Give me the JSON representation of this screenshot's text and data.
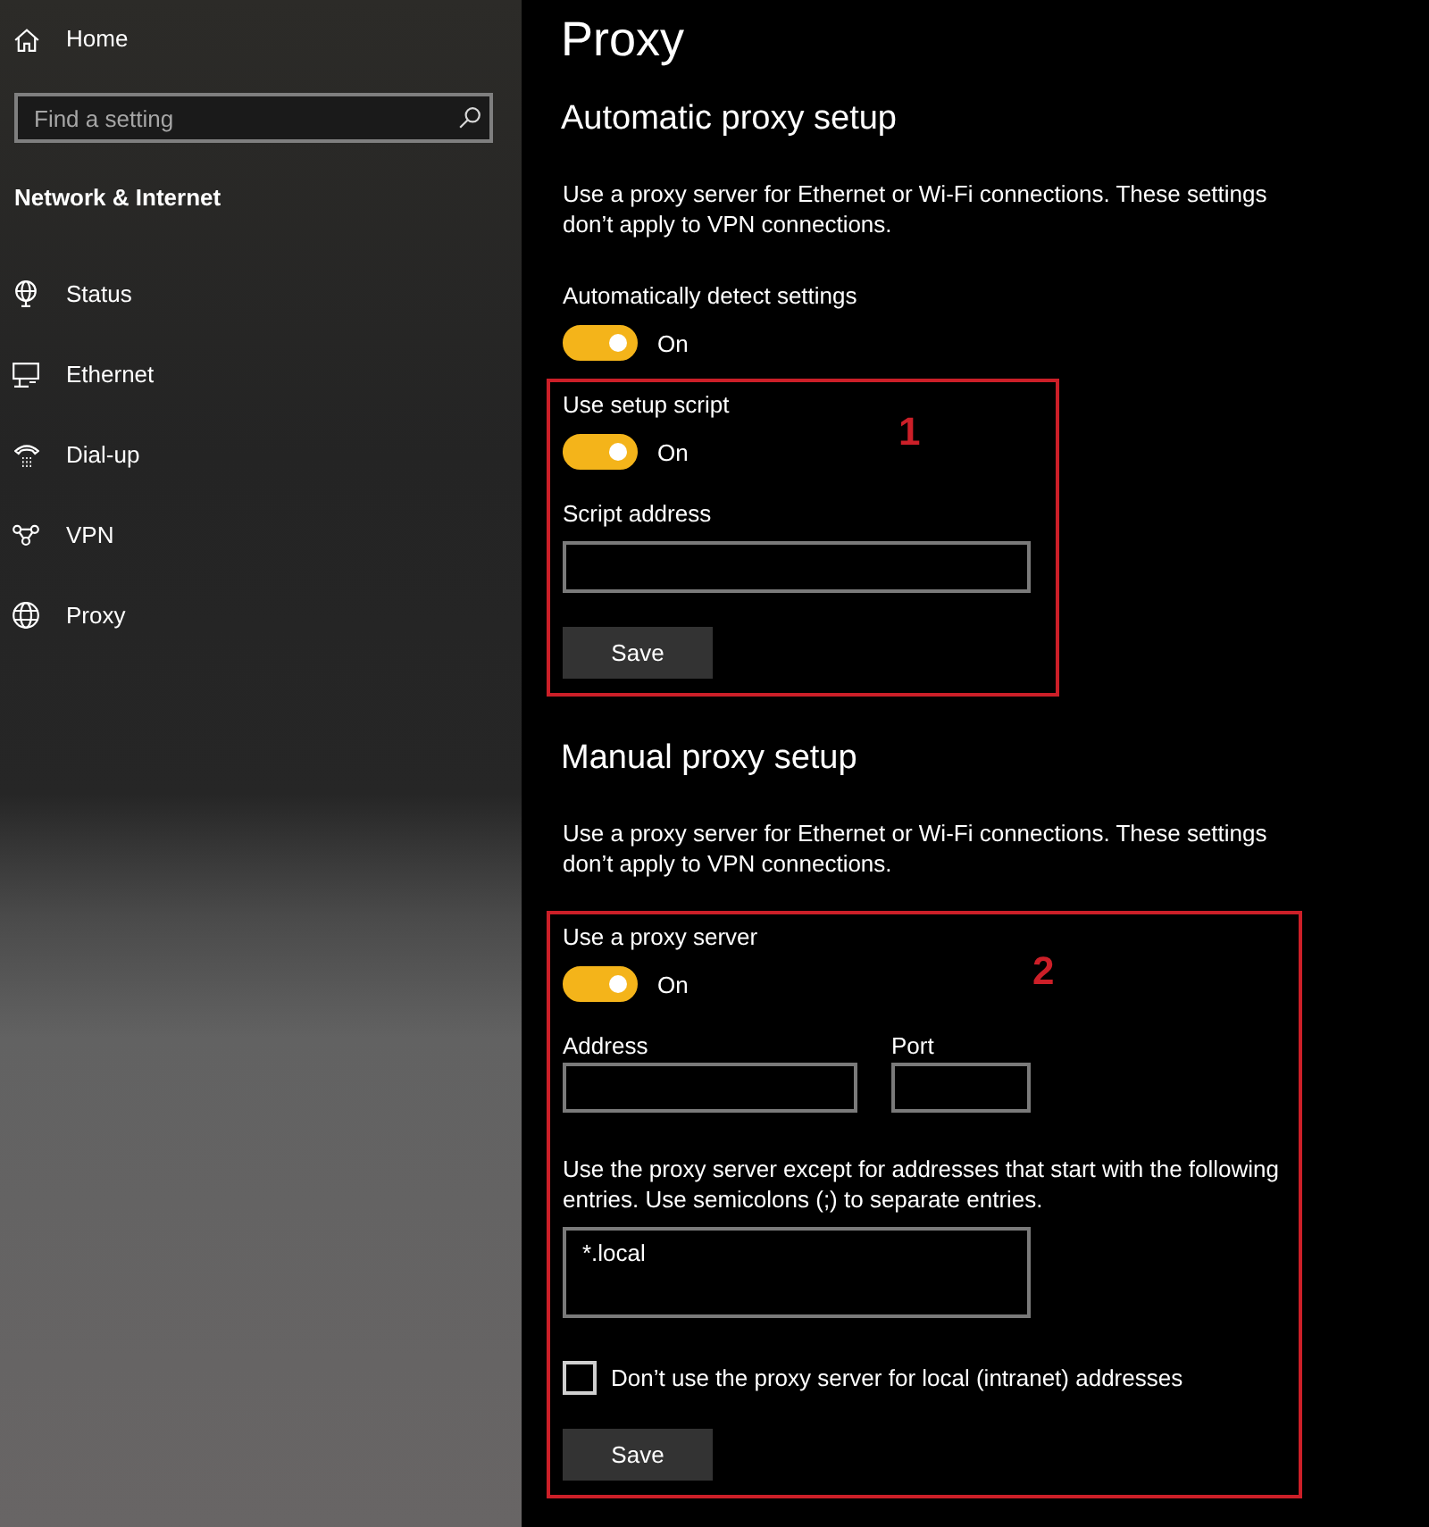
{
  "sidebar": {
    "home": "Home",
    "search": {
      "placeholder": "Find a setting"
    },
    "category": "Network & Internet",
    "items": [
      {
        "kind": "status",
        "label": "Status"
      },
      {
        "kind": "ethernet",
        "label": "Ethernet"
      },
      {
        "kind": "dialup",
        "label": "Dial-up"
      },
      {
        "kind": "vpn",
        "label": "VPN"
      },
      {
        "kind": "proxy",
        "label": "Proxy"
      }
    ]
  },
  "page": {
    "title": "Proxy"
  },
  "sections": [
    {
      "heading": "Automatic proxy setup",
      "description": "Use a proxy server for Ethernet or Wi-Fi connections. These settings don’t apply to VPN connections.",
      "settings": [
        {
          "kind": "toggle",
          "label": "Automatically detect settings",
          "on": true,
          "state_text": "On"
        }
      ],
      "annotation_box": {
        "number": "1",
        "settings": [
          {
            "kind": "toggle",
            "label": "Use setup script",
            "on": true,
            "state_text": "On"
          },
          {
            "kind": "text_field",
            "label": "Script address"
          },
          {
            "kind": "button",
            "label": "Save"
          }
        ]
      }
    },
    {
      "heading": "Manual proxy setup",
      "description": "Use a proxy server for Ethernet or Wi-Fi connections. These settings don’t apply to VPN connections.",
      "annotation_box": {
        "number": "2",
        "settings": [
          {
            "kind": "toggle",
            "label": "Use a proxy server",
            "on": true,
            "state_text": "On"
          },
          {
            "kind": "field_row",
            "fields": [
              {
                "label": "Address"
              },
              {
                "label": "Port"
              }
            ]
          },
          {
            "kind": "text_area",
            "label": "Use the proxy server except for addresses that start with the following entries. Use semicolons (;) to separate entries.",
            "value": "*.local"
          },
          {
            "kind": "checkbox",
            "label": "Don’t use the proxy server for local (intranet) addresses",
            "checked": false
          },
          {
            "kind": "button",
            "label": "Save"
          }
        ]
      }
    }
  ]
}
